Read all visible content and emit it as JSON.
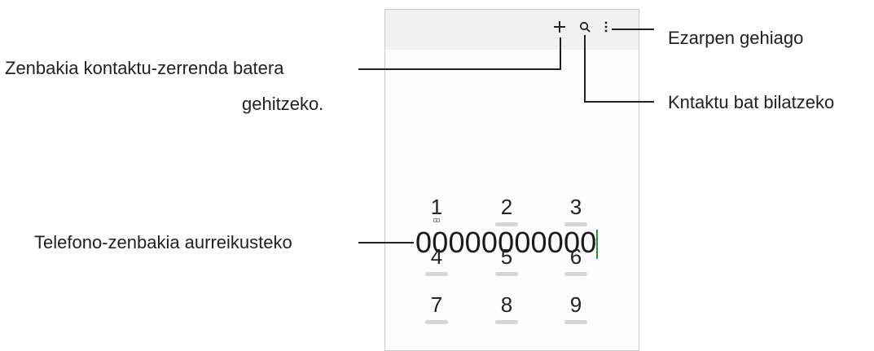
{
  "phone": {
    "number_display": "00000000000",
    "top_icons": [
      "plus-icon",
      "search-icon",
      "more-options-icon"
    ],
    "keypad": [
      {
        "digit": "1",
        "sub": "ꝏ"
      },
      {
        "digit": "2",
        "sub": ""
      },
      {
        "digit": "3",
        "sub": ""
      },
      {
        "digit": "4",
        "sub": ""
      },
      {
        "digit": "5",
        "sub": ""
      },
      {
        "digit": "6",
        "sub": ""
      },
      {
        "digit": "7",
        "sub": ""
      },
      {
        "digit": "8",
        "sub": ""
      },
      {
        "digit": "9",
        "sub": ""
      }
    ]
  },
  "callouts": {
    "more_options": "Ezarpen gehiago",
    "add_contact_line1": "Zenbakia kontaktu-zerrenda batera",
    "add_contact_line2": "gehitzeko.",
    "search": "Kntaktu bat bilatzeko",
    "preview": "Telefono-zenbakia aurreikusteko"
  },
  "colors": {
    "cursor": "#2f8f3f",
    "topbar": "#f1f1f1",
    "frame": "#c9c9c9"
  }
}
